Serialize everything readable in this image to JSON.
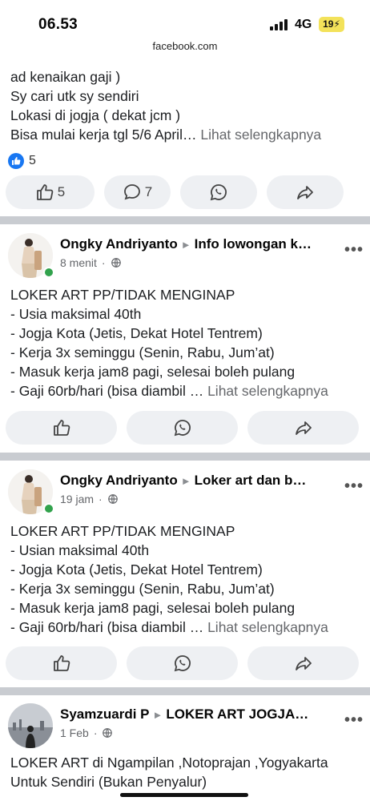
{
  "status_bar": {
    "time": "06.53",
    "network": "4G",
    "battery": "19"
  },
  "browser": {
    "url": "facebook.com"
  },
  "post1": {
    "text_lines": [
      "ad kenaikan gaji )",
      "Sy cari utk sy sendiri",
      "Lokasi di jogja ( dekat jcm )",
      "Bisa mulai kerja tgl 5/6 April…"
    ],
    "see_more": "Lihat selengkapnya",
    "reaction_count": "5",
    "like_count": "5",
    "comment_count": "7"
  },
  "post2": {
    "author": "Ongky Andriyanto",
    "group": "Info lowongan k…",
    "time": "8 menit",
    "text_lines": [
      "LOKER ART PP/TIDAK MENGINAP",
      "- Usia maksimal 40th",
      "- Jogja Kota (Jetis, Dekat Hotel Tentrem)",
      "- Kerja 3x seminggu (Senin, Rabu, Jum’at)",
      "- Masuk kerja jam8 pagi, selesai boleh pulang",
      "- Gaji 60rb/hari (bisa diambil …"
    ],
    "see_more": "Lihat selengkapnya"
  },
  "post3": {
    "author": "Ongky Andriyanto",
    "group": "Loker art dan b…",
    "time": "19 jam",
    "text_lines": [
      "LOKER ART PP/TIDAK MENGINAP",
      "- Usian maksimal 40th",
      "- Jogja Kota (Jetis, Dekat Hotel Tentrem)",
      "- Kerja 3x seminggu (Senin, Rabu, Jum’at)",
      "- Masuk kerja jam8 pagi, selesai boleh pulang",
      "- Gaji 60rb/hari (bisa diambil …"
    ],
    "see_more": "Lihat selengkapnya"
  },
  "post4": {
    "author": "Syamzuardi P",
    "group": "LOKER ART JOGJA…",
    "time": "1 Feb",
    "text_lines": [
      "LOKER ART di Ngampilan ,Notoprajan ,Yogyakarta",
      "Untuk Sendiri (Bukan Penyalur)"
    ]
  },
  "colors": {
    "accent": "#1877f2",
    "online": "#31a24c",
    "separator": "#c9ccd1",
    "button_bg": "#eef0f3"
  },
  "icons": [
    "thumbs-up-icon",
    "comment-icon",
    "whatsapp-icon",
    "share-icon",
    "globe-icon",
    "more-icon"
  ]
}
